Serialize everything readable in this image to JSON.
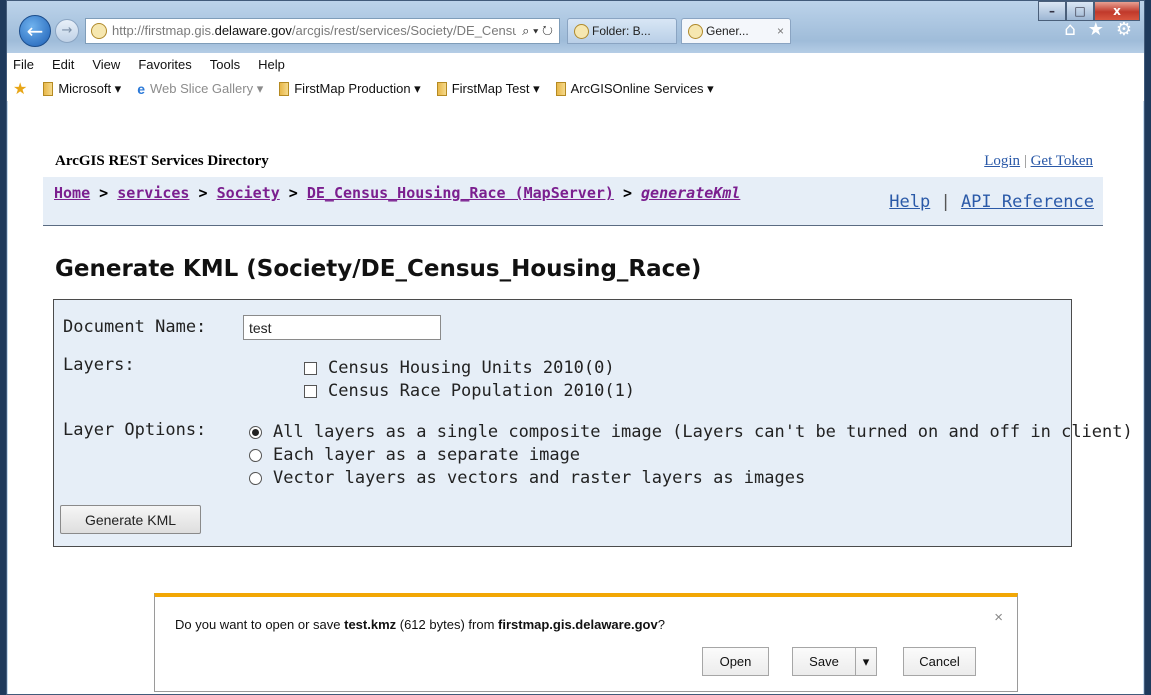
{
  "browser": {
    "address": {
      "pre": "http://firstmap.gis.",
      "domain": "delaware.gov",
      "post": "/arcgis/rest/services/Society/DE_Census_Housing"
    },
    "address_tools": "⌕ ▾ ↻",
    "tabs": [
      {
        "label": "Folder: B..."
      },
      {
        "label": "Gener...",
        "close": "×"
      }
    ],
    "menu": [
      "File",
      "Edit",
      "View",
      "Favorites",
      "Tools",
      "Help"
    ],
    "favorites": [
      "Microsoft ▾",
      "Web Slice Gallery ▾",
      "FirstMap Production ▾",
      "FirstMap Test ▾",
      "ArcGISOnline Services ▾"
    ],
    "window_controls": {
      "minimize": "–",
      "maximize": "□",
      "close": "x"
    },
    "icons": {
      "home": "⌂",
      "favorites": "★",
      "tools": "⚙"
    }
  },
  "page": {
    "service_title": "ArcGIS REST Services Directory",
    "login": "Login",
    "link_sep": " | ",
    "get_token": "Get Token",
    "breadcrumb": {
      "home": "Home",
      "services": "services",
      "society": "Society",
      "mapserver": "DE_Census_Housing_Race (MapServer)",
      "current": "generateKml",
      "sep": " > "
    },
    "help": "Help",
    "api_reference": "API Reference",
    "title": "Generate KML (Society/DE_Census_Housing_Race)"
  },
  "form": {
    "document_name_label": "Document Name:",
    "document_name_value": "test",
    "layers_label": "Layers:",
    "layers": [
      "Census Housing Units 2010(0)",
      "Census Race Population 2010(1)"
    ],
    "layer_options_label": "Layer Options:",
    "layer_options": [
      "All layers as a single composite image (Layers can't be turned on and off in client)",
      "Each layer as a separate image",
      "Vector layers as vectors and raster layers as images"
    ],
    "selected_option": 0,
    "submit": "Generate KML"
  },
  "download_bar": {
    "prefix": "Do you want to open or save ",
    "filename": "test.kmz",
    "mid": " (612 bytes) from ",
    "host": "firstmap.gis.delaware.gov",
    "suffix": "?",
    "open": "Open",
    "save": "Save",
    "save_menu": "▾",
    "cancel": "Cancel",
    "close": "×"
  }
}
